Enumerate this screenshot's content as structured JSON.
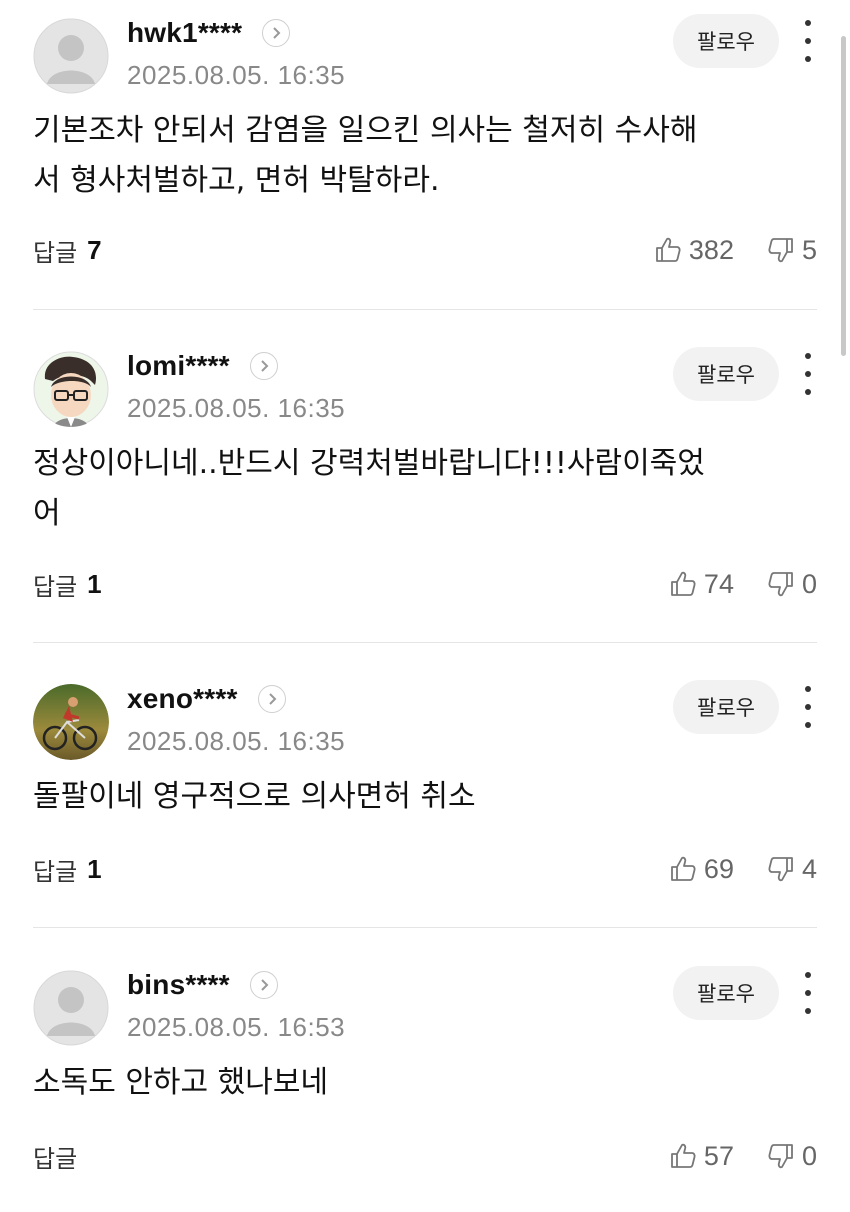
{
  "follow_label": "팔로우",
  "reply_label": "답글",
  "comments": [
    {
      "username": "hwk1****",
      "timestamp": "2025.08.05. 16:35",
      "text": "기본조차 안되서 감염을 일으킨 의사는 철저히 수사해\n서 형사처벌하고, 면허 박탈하라.",
      "replies": "7",
      "likes": "382",
      "dislikes": "5",
      "avatar": "default-avatar"
    },
    {
      "username": "lomi****",
      "timestamp": "2025.08.05. 16:35",
      "text": "정상이아니네..반드시 강력처벌바랍니다!!!사람이죽었\n어",
      "replies": "1",
      "likes": "74",
      "dislikes": "0",
      "avatar": "cartoon-avatar"
    },
    {
      "username": "xeno****",
      "timestamp": "2025.08.05. 16:35",
      "text": "돌팔이네 영구적으로 의사면허 취소",
      "replies": "1",
      "likes": "69",
      "dislikes": "4",
      "avatar": "cyclist-photo-avatar"
    },
    {
      "username": "bins****",
      "timestamp": "2025.08.05. 16:53",
      "text": "소독도 안하고 했나보네",
      "replies": "",
      "likes": "57",
      "dislikes": "0",
      "avatar": "default-avatar"
    }
  ]
}
